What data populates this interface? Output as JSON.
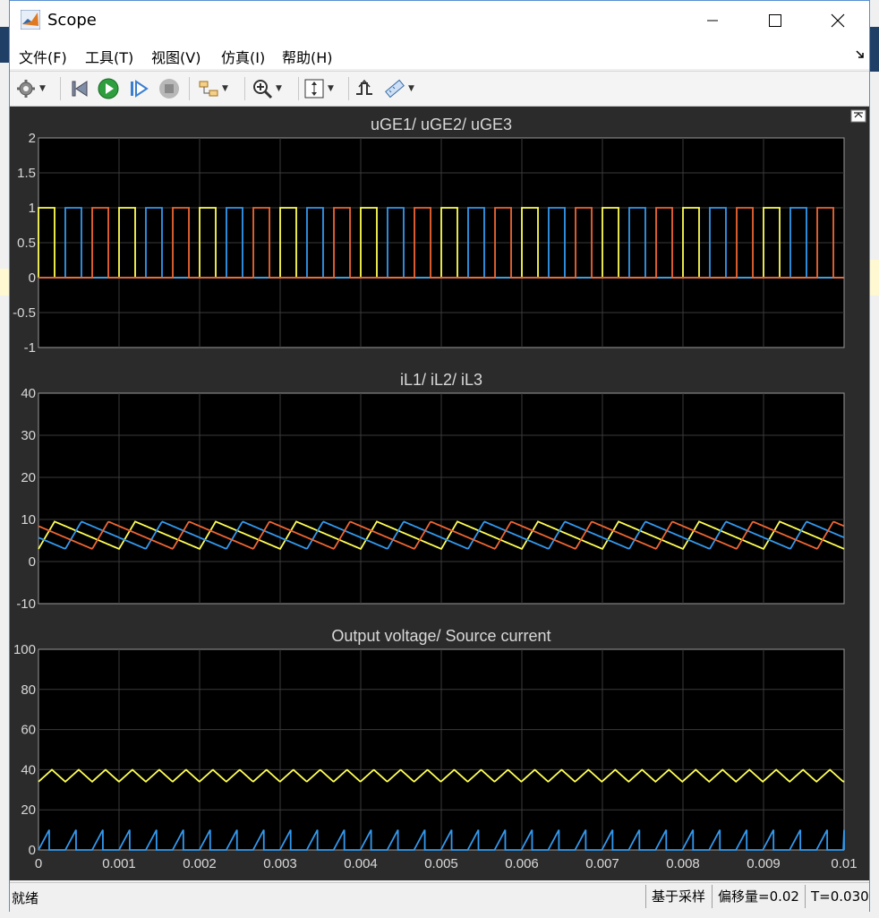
{
  "window": {
    "title": "Scope"
  },
  "menu": [
    "文件(F)",
    "工具(T)",
    "视图(V)",
    "仿真(I)",
    "帮助(H)"
  ],
  "toolbar": {
    "icons": [
      "gear-icon",
      "step-back-icon",
      "run-icon",
      "step-forward-icon",
      "stop-icon",
      "signal-selector-icon",
      "zoom-icon",
      "scale-axes-icon",
      "triggers-icon",
      "measurements-icon"
    ]
  },
  "colors": {
    "series_yellow": "#ffff55",
    "series_blue": "#3399ee",
    "series_orange": "#ee6633",
    "plot_bg": "#000000",
    "figure_bg": "#2b2b2b"
  },
  "chart_data": [
    {
      "type": "line",
      "title": "uGE1/ uGE2/ uGE3",
      "xlim": [
        0,
        0.01
      ],
      "ylim": [
        -1,
        2
      ],
      "yticks": [
        "2",
        "1.5",
        "1",
        "0.5",
        "0",
        "-0.5",
        "-1"
      ],
      "grid": true,
      "period": 0.001,
      "series": [
        {
          "color": "#ffff55",
          "phase": 0.0,
          "duty": 0.2,
          "low": 0,
          "high": 1
        },
        {
          "color": "#3399ee",
          "phase": 0.000333,
          "duty": 0.2,
          "low": 0,
          "high": 1
        },
        {
          "color": "#ee6633",
          "phase": 0.000667,
          "duty": 0.2,
          "low": 0,
          "high": 1
        }
      ]
    },
    {
      "type": "line",
      "title": "iL1/ iL2/ iL3",
      "xlim": [
        0,
        0.01
      ],
      "ylim": [
        -10,
        40
      ],
      "yticks": [
        "40",
        "30",
        "20",
        "10",
        "0",
        "-10"
      ],
      "grid": true,
      "period": 0.001,
      "series": [
        {
          "color": "#ffff55",
          "phase": 0.0,
          "min": 3.0,
          "max": 9.5
        },
        {
          "color": "#3399ee",
          "phase": 0.000333,
          "min": 3.0,
          "max": 9.5
        },
        {
          "color": "#ee6633",
          "phase": 0.000667,
          "min": 3.0,
          "max": 9.5
        }
      ]
    },
    {
      "type": "line",
      "title": "Output voltage/ Source current",
      "xlim": [
        0,
        0.01
      ],
      "ylim": [
        0,
        100
      ],
      "yticks": [
        "100",
        "80",
        "60",
        "40",
        "20",
        "0"
      ],
      "xticks": [
        "0",
        "0.001",
        "0.002",
        "0.003",
        "0.004",
        "0.005",
        "0.006",
        "0.007",
        "0.008",
        "0.009",
        "0.01"
      ],
      "grid": true,
      "period": 0.000333,
      "series": [
        {
          "color": "#ffff55",
          "kind": "triangle",
          "min": 34,
          "max": 40
        },
        {
          "color": "#3399ee",
          "kind": "sawtooth",
          "min": 0,
          "max": 10
        }
      ]
    }
  ],
  "status": {
    "left": "就绪",
    "sample_based": "基于采样",
    "offset": "偏移量=0.02",
    "time": "T=0.030"
  }
}
